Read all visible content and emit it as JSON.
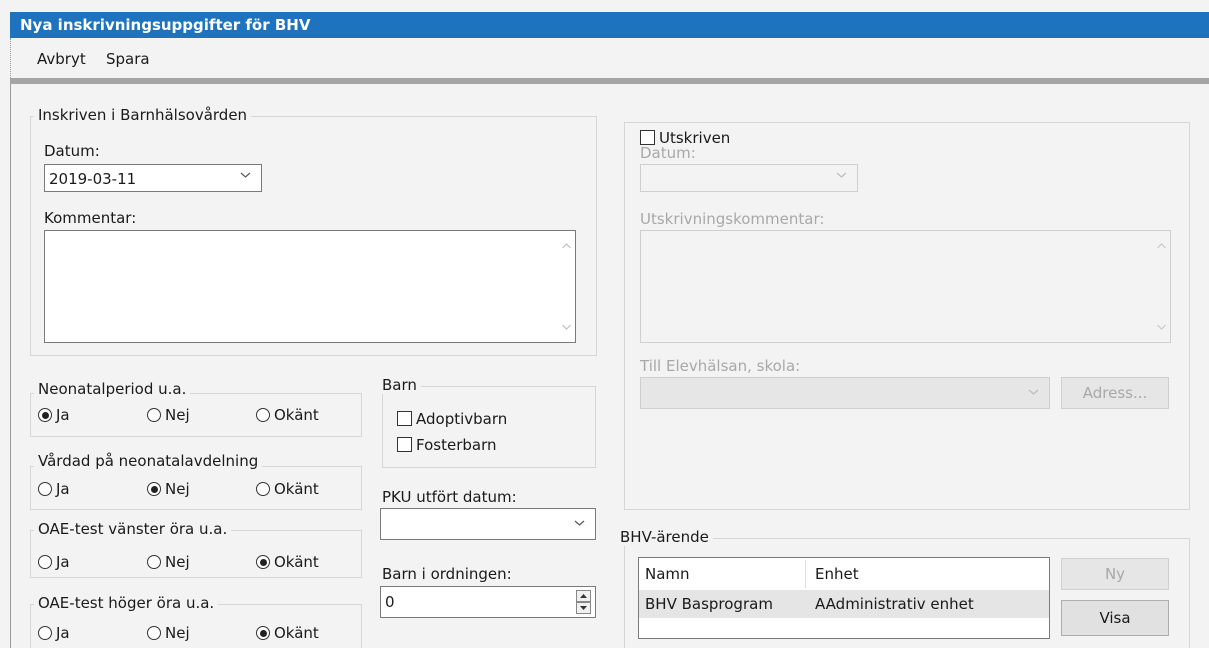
{
  "window": {
    "title": "Nya inskrivningsuppgifter för BHV"
  },
  "toolbar": {
    "cancel": "Avbryt",
    "save": "Spara"
  },
  "inskriven": {
    "legend": "Inskriven i Barnhälsovården",
    "date_label": "Datum:",
    "date_value": "2019-03-11",
    "comment_label": "Kommentar:",
    "comment_value": ""
  },
  "utskriven": {
    "checkbox_label": "Utskriven",
    "checked": false,
    "date_label": "Datum:",
    "date_value": "",
    "comment_label": "Utskrivningskommentar:",
    "comment_value": "",
    "school_label": "Till Elevhälsan, skola:",
    "school_value": "",
    "address_button": "Adress..."
  },
  "radio_groups": [
    {
      "legend": "Neonatalperiod u.a.",
      "options": [
        "Ja",
        "Nej",
        "Okänt"
      ],
      "selected": "Ja"
    },
    {
      "legend": "Vårdad på neonatalavdelning",
      "options": [
        "Ja",
        "Nej",
        "Okänt"
      ],
      "selected": "Nej"
    },
    {
      "legend": "OAE-test vänster öra u.a.",
      "options": [
        "Ja",
        "Nej",
        "Okänt"
      ],
      "selected": "Okänt"
    },
    {
      "legend": "OAE-test höger öra u.a.",
      "options": [
        "Ja",
        "Nej",
        "Okänt"
      ],
      "selected": "Okänt"
    }
  ],
  "barn": {
    "legend": "Barn",
    "adoptiv": "Adoptivbarn",
    "foster": "Fosterbarn"
  },
  "pku": {
    "label": "PKU utfört datum:",
    "value": ""
  },
  "ordning": {
    "label": "Barn i ordningen:",
    "value": "0"
  },
  "arende": {
    "legend": "BHV-ärende",
    "columns": [
      "Namn",
      "Enhet"
    ],
    "rows": [
      [
        "BHV Basprogram",
        "AAdministrativ enhet"
      ]
    ],
    "new_button": "Ny",
    "show_button": "Visa"
  },
  "colors": {
    "titlebar": "#1e73be",
    "background": "#f3f3f3",
    "selected_row": "#e5e5e5"
  }
}
